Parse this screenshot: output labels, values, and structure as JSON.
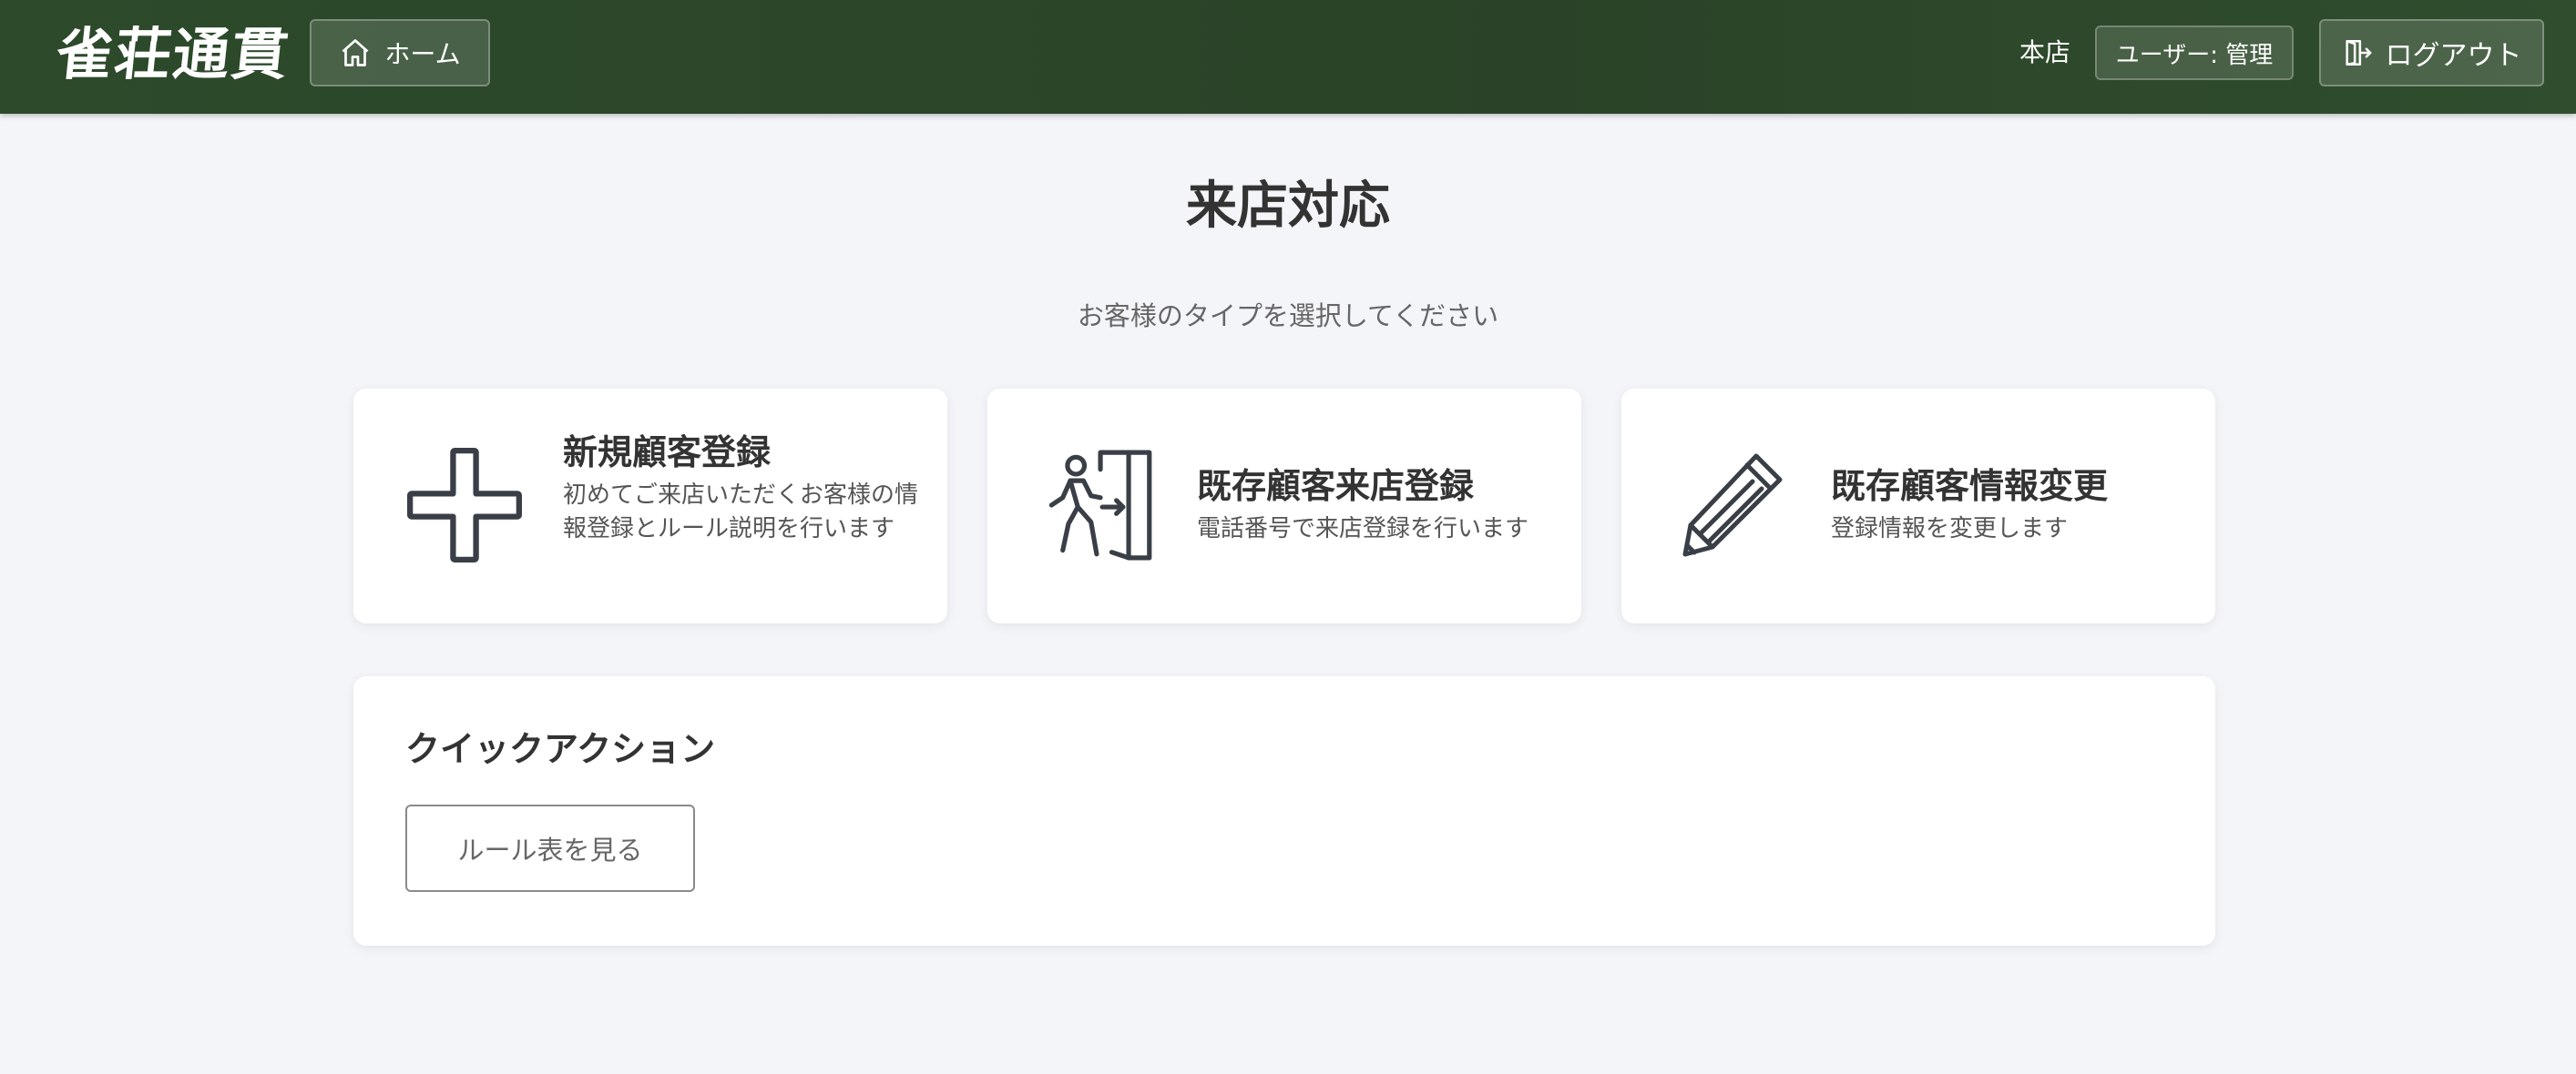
{
  "header": {
    "logo_text": "雀荘通貫",
    "home_label": "ホーム",
    "store_label": "本店",
    "user_label": "ユーザー: 管理",
    "logout_label": "ログアウト"
  },
  "main": {
    "title": "来店対応",
    "subtitle": "お客様のタイプを選択してください",
    "cards": [
      {
        "title": "新規顧客登録",
        "description": "初めてご来店いただくお客様の情報登録とルール説明を行います",
        "icon": "plus-icon"
      },
      {
        "title": "既存顧客来店登録",
        "description": "電話番号で来店登録を行います",
        "icon": "person-enter-door-icon"
      },
      {
        "title": "既存顧客情報変更",
        "description": "登録情報を変更します",
        "icon": "pencil-icon"
      }
    ]
  },
  "quick_actions": {
    "title": "クイックアクション",
    "rule_button_label": "ルール表を見る"
  },
  "colors": {
    "header_bg": "#2d4a2b",
    "page_bg": "#f4f5f9",
    "card_bg": "#ffffff",
    "icon_stroke": "#3a3f47"
  }
}
